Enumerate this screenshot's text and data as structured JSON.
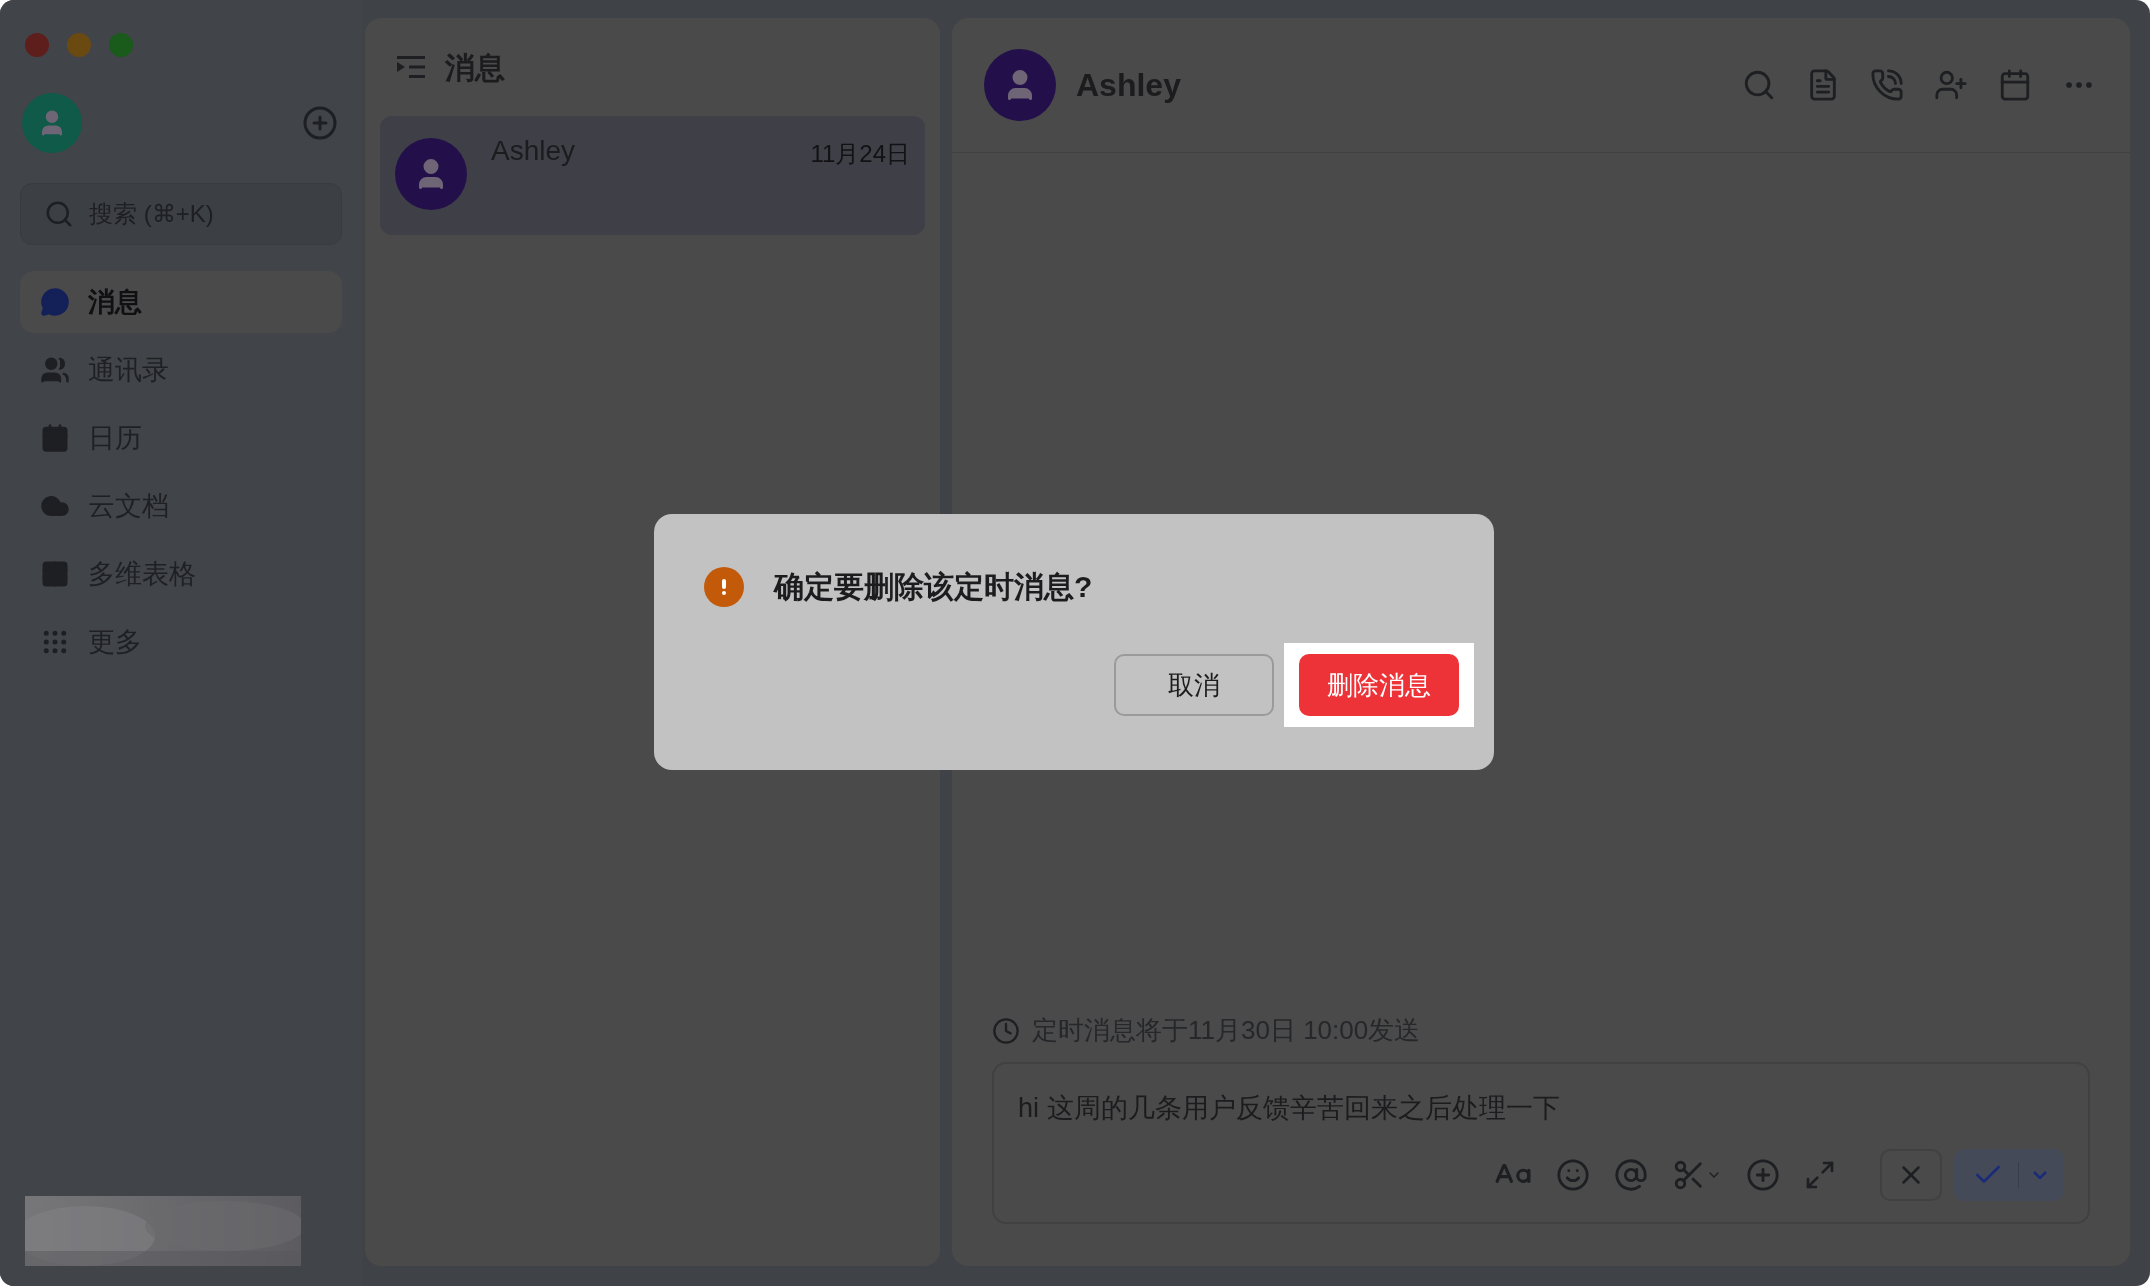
{
  "sidebar": {
    "search": {
      "placeholder": "搜索 (⌘+K)"
    },
    "nav": [
      {
        "label": "消息",
        "selected": true
      },
      {
        "label": "通讯录",
        "selected": false
      },
      {
        "label": "日历",
        "selected": false
      },
      {
        "label": "云文档",
        "selected": false
      },
      {
        "label": "多维表格",
        "selected": false
      },
      {
        "label": "更多",
        "selected": false
      }
    ]
  },
  "list": {
    "title": "消息",
    "conversations": [
      {
        "name": "Ashley",
        "date": "11月24日",
        "selected": true
      }
    ]
  },
  "chat": {
    "name": "Ashley",
    "schedule_note": "定时消息将于11月30日 10:00发送",
    "composer": {
      "value": "hi 这周的几条用户反馈辛苦回来之后处理一下"
    }
  },
  "dialog": {
    "message": "确定要删除该定时消息?",
    "buttons": [
      {
        "label": "取消",
        "kind": "secondary",
        "highlighted": false
      },
      {
        "label": "删除消息",
        "kind": "primary",
        "highlighted": true
      }
    ]
  }
}
